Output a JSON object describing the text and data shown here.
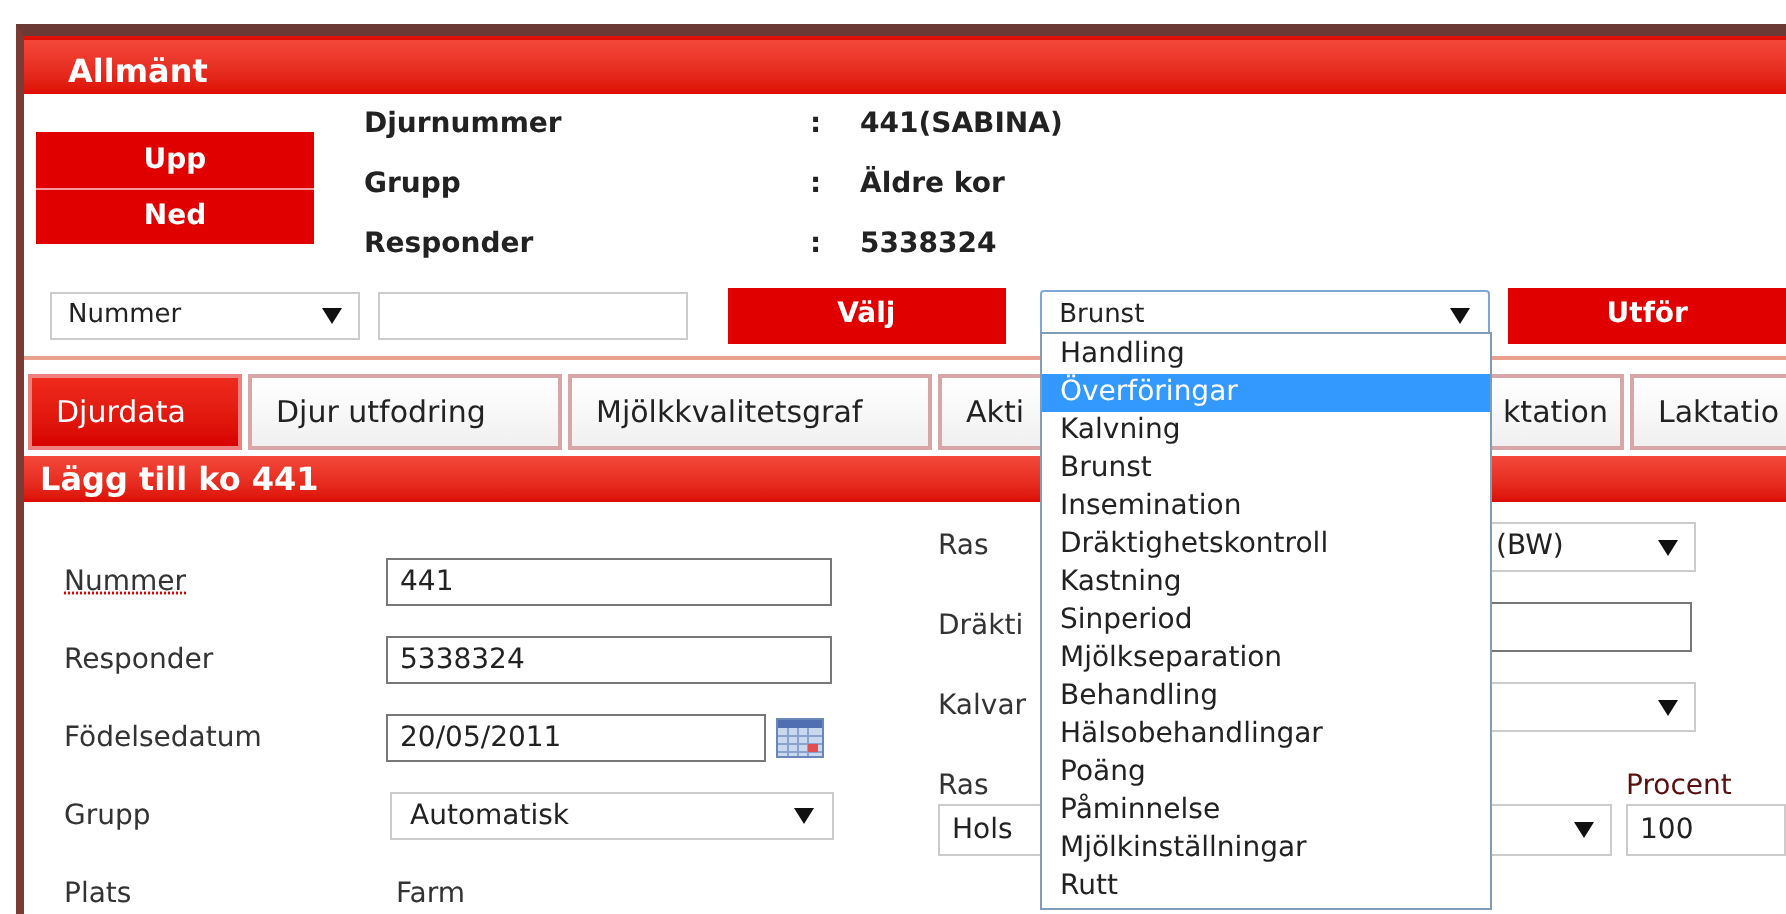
{
  "header": {
    "title": "Allmänt"
  },
  "nav_buttons": [
    "Upp",
    "Ned"
  ],
  "animal_info": [
    {
      "label": "Djurnummer",
      "separator": ":",
      "value": "441(SABINA)"
    },
    {
      "label": "Grupp",
      "separator": ":",
      "value": "Äldre kor"
    },
    {
      "label": "Responder",
      "separator": ":",
      "value": "5338324"
    }
  ],
  "search": {
    "field": "Nummer",
    "button": "Välj"
  },
  "action": {
    "value": "Brunst",
    "expanded": true,
    "button": "Utför",
    "options": [
      {
        "label": "Handling",
        "highlighted": false
      },
      {
        "label": "Överföringar",
        "highlighted": true
      },
      {
        "label": "Kalvning",
        "highlighted": false
      },
      {
        "label": "Brunst",
        "highlighted": false
      },
      {
        "label": "Insemination",
        "highlighted": false
      },
      {
        "label": "Dräktighetskontroll",
        "highlighted": false
      },
      {
        "label": "Kastning",
        "highlighted": false
      },
      {
        "label": "Sinperiod",
        "highlighted": false
      },
      {
        "label": "Mjölkseparation",
        "highlighted": false
      },
      {
        "label": "Behandling",
        "highlighted": false
      },
      {
        "label": "Hälsobehandlingar",
        "highlighted": false
      },
      {
        "label": "Poäng",
        "highlighted": false
      },
      {
        "label": "Påminnelse",
        "highlighted": false
      },
      {
        "label": "Mjölkinställningar",
        "highlighted": false
      },
      {
        "label": "Rutt",
        "highlighted": false
      }
    ]
  },
  "tabs": [
    {
      "label": "Djurdata",
      "selected": true
    },
    {
      "label": "Djur utfodring",
      "selected": false
    },
    {
      "label": "Mjölkkvalitetsgraf",
      "selected": false
    },
    {
      "label": "Akti",
      "label_end": "ktation",
      "selected": false
    },
    {
      "label": "Laktatio",
      "selected": false
    }
  ],
  "section_title": "Lägg till ko 441",
  "form_left": [
    {
      "kind": "text",
      "label": "Nummer",
      "value": "441",
      "flagged": true
    },
    {
      "kind": "text",
      "label": "Responder",
      "value": "5338324",
      "flagged": false
    },
    {
      "kind": "date",
      "label": "Födelsedatum",
      "value": "20/05/2011",
      "flagged": false
    },
    {
      "kind": "select",
      "label": "Grupp",
      "value": "Automatisk",
      "flagged": false
    },
    {
      "kind": "static",
      "label": "Plats",
      "value": "Farm",
      "flagged": false
    }
  ],
  "form_right": [
    {
      "kind": "select",
      "label": "Ras",
      "value": "(BW)"
    },
    {
      "kind": "text",
      "label": "Dräkti"
    },
    {
      "kind": "select",
      "label": "Kalvar"
    }
  ],
  "breed": {
    "label": "Ras",
    "value": "Hols",
    "percent_label": "Procent",
    "percent": "100"
  }
}
